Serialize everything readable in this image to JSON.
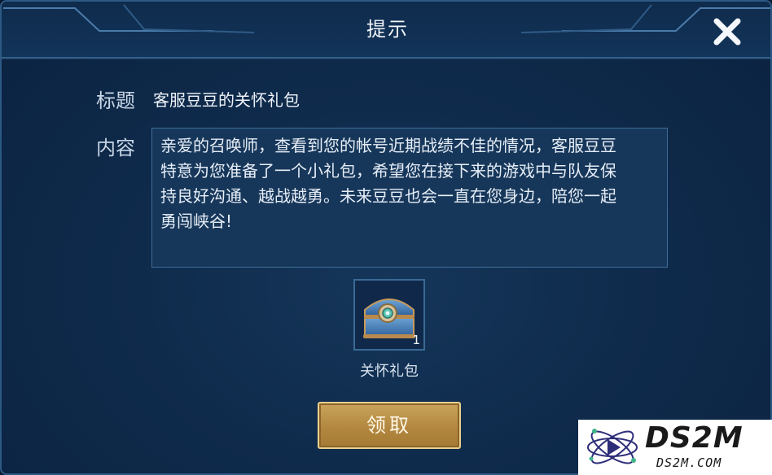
{
  "dialog": {
    "title": "提示",
    "close_icon": "close-icon"
  },
  "fields": {
    "title_label": "标题",
    "title_value": "客服豆豆的关怀礼包",
    "content_label": "内容",
    "content_lines": [
      "亲爱的召唤师，查看到您的帐号近期战绩不佳的情况，客服豆豆",
      "特意为您准备了一个小礼包，希望您在接下来的游戏中与队友保",
      "持良好沟通、越战越勇。未来豆豆也会一直在您身边，陪您一起",
      "勇闯峡谷!"
    ]
  },
  "reward": {
    "icon": "treasure-chest-icon",
    "count": "1",
    "label": "关怀礼包"
  },
  "actions": {
    "claim_label": "领取"
  },
  "watermark": {
    "brand": "DS2M",
    "domain": "DS2M.COM"
  },
  "colors": {
    "background": "#0f2b4c",
    "border": "#2c5a85",
    "button_gold": "#b3873f",
    "button_border": "#e7cf8d"
  }
}
